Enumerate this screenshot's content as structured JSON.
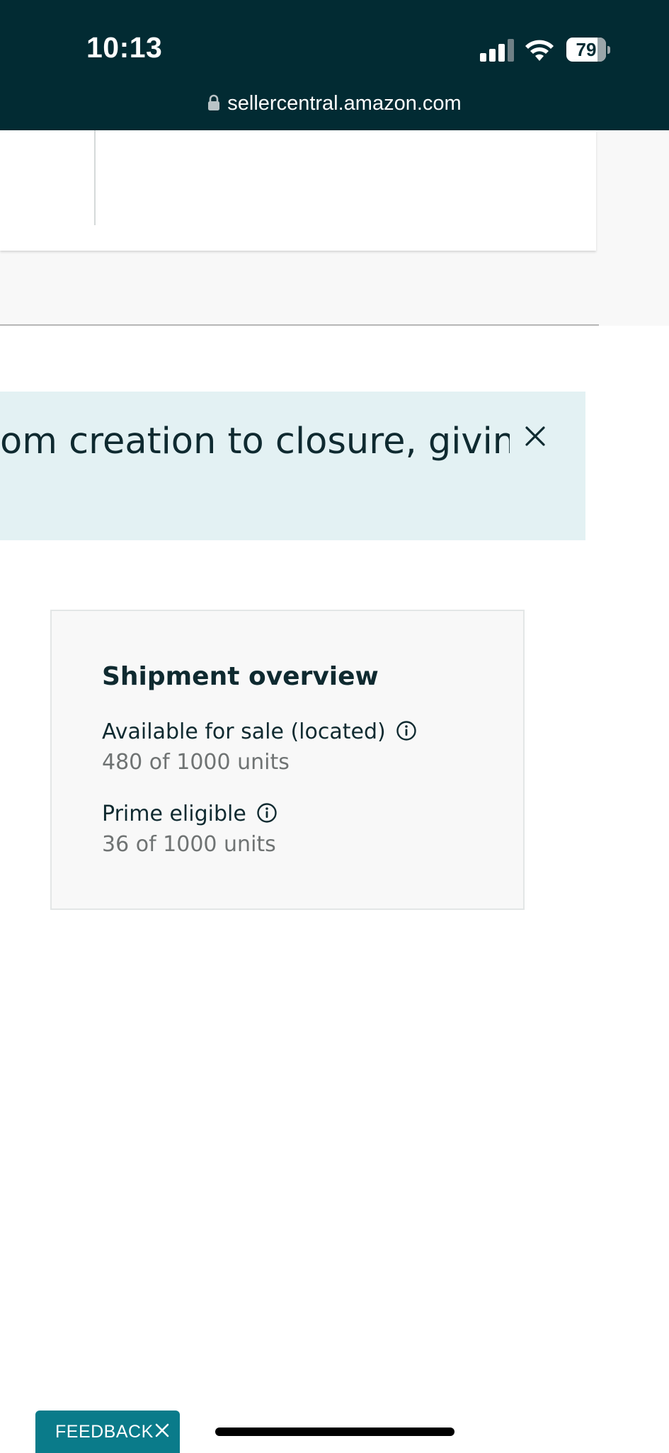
{
  "status_bar": {
    "time": "10:13",
    "battery_level": "79",
    "signal_icon": "cellular-signal-icon",
    "wifi_icon": "wifi-icon",
    "battery_icon": "battery-icon"
  },
  "browser": {
    "url": "sellercentral.amazon.com",
    "lock_icon": "lock-icon"
  },
  "banner": {
    "text": "om creation to closure, giving",
    "close_icon": "close-icon",
    "background": "#e3f1f3"
  },
  "shipment_overview": {
    "title": "Shipment overview",
    "items": [
      {
        "label": "Available for sale (located)",
        "value": "480 of 1000 units",
        "icon": "info-icon"
      },
      {
        "label": "Prime eligible",
        "value": "36 of 1000 units",
        "icon": "info-icon"
      }
    ]
  },
  "feedback": {
    "label": "FEEDBACK",
    "close_icon": "close-icon",
    "color": "#0a7b8a"
  },
  "colors": {
    "top_bar": "#022b33",
    "text_dark": "#0f2a30",
    "text_muted": "#6f7373"
  }
}
